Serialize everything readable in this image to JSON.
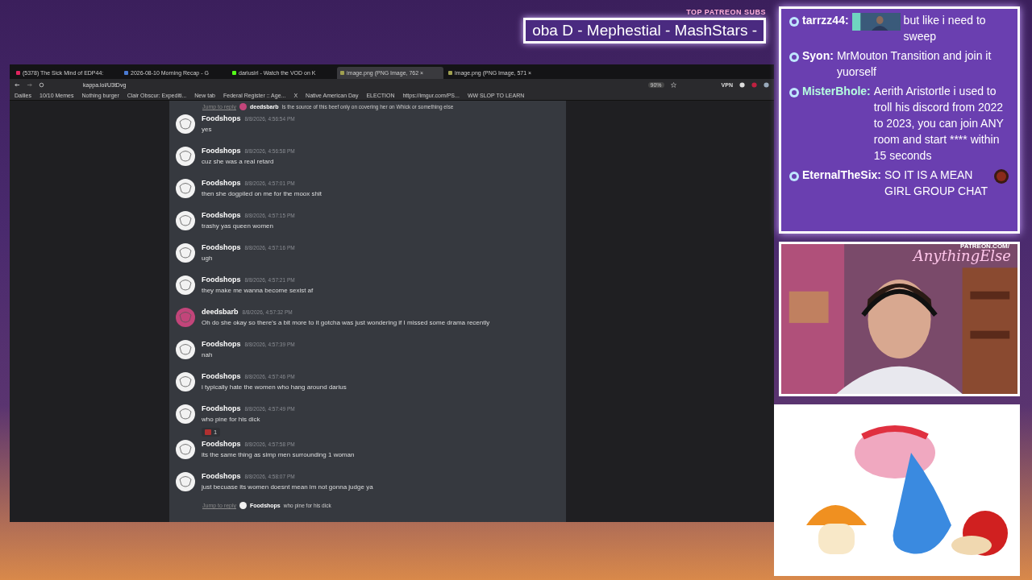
{
  "overlay": {
    "patreon_label": "TOP PATREON SUBS",
    "patreon_ticker": "oba D - Mephestial - MashStars -",
    "patreon_url": "PATREON.COM/",
    "signature": "AnythingElse"
  },
  "browser": {
    "tabs": [
      {
        "title": "(5378) The Sick Mind of EDP44: ",
        "color": "#e0245e",
        "selected": false
      },
      {
        "title": "2026-08-10 Morning Recap - G",
        "color": "#4a7bd4",
        "selected": false
      },
      {
        "title": "dariusirl - Watch the VOD on K",
        "color": "#53fc18",
        "selected": false
      },
      {
        "title": "image.png (PNG Image, 762 ×",
        "color": "#a0a050",
        "selected": true
      },
      {
        "title": "image.png (PNG Image, 571 ×",
        "color": "#a0a050",
        "selected": false
      }
    ],
    "address": "kappa.lol/U3tDvg",
    "zoom": "90%",
    "vpn": "VPN",
    "bookmarks": [
      "Dailies",
      "10/10 Memes",
      "Nothing burger",
      "Clair Obscur: Expediti...",
      "New tab",
      "Federal Register :: Age...",
      "X",
      "Native American Day",
      "ELECTION",
      "https://imgur.com/PS...",
      "WW SLOP TO LEARN"
    ]
  },
  "discord": {
    "reply_top": {
      "label": "Jump to reply",
      "author": "deedsbarb",
      "text": "Is the source of this beef only on covering her on Whick or something else",
      "color": "#c2457a"
    },
    "messages": [
      {
        "author": "Foodshops",
        "time": "8/8/2026, 4:56:54 PM",
        "text": "yes",
        "color": "#f2f2f2"
      },
      {
        "author": "Foodshops",
        "time": "8/8/2026, 4:56:58 PM",
        "text": "cuz she was a real retard",
        "color": "#f2f2f2"
      },
      {
        "author": "Foodshops",
        "time": "8/8/2026, 4:57:01 PM",
        "text": "then she dogpiled on me for the moox shit",
        "color": "#f2f2f2"
      },
      {
        "author": "Foodshops",
        "time": "8/8/2026, 4:57:15 PM",
        "text": "trashy yas queen women",
        "color": "#f2f2f2"
      },
      {
        "author": "Foodshops",
        "time": "8/8/2026, 4:57:16 PM",
        "text": "ugh",
        "color": "#f2f2f2"
      },
      {
        "author": "Foodshops",
        "time": "8/8/2026, 4:57:21 PM",
        "text": "they make me wanna become sexist af",
        "color": "#f2f2f2"
      },
      {
        "author": "deedsbarb",
        "time": "8/8/2026, 4:57:32 PM",
        "text": "Oh do she okay so there's a bit more to it gotcha was just wondering if I missed some drama recently",
        "color": "#c2457a"
      },
      {
        "author": "Foodshops",
        "time": "8/8/2026, 4:57:39 PM",
        "text": "nah",
        "color": "#f2f2f2"
      },
      {
        "author": "Foodshops",
        "time": "8/8/2026, 4:57:46 PM",
        "text": "i typically hate the women who hang around darius",
        "color": "#f2f2f2"
      },
      {
        "author": "Foodshops",
        "time": "8/8/2026, 4:57:49 PM",
        "text": "who pine for his dick",
        "color": "#f2f2f2",
        "reaction": "1"
      },
      {
        "author": "Foodshops",
        "time": "8/8/2026, 4:57:58 PM",
        "text": "its the same thing as simp men surrounding 1 woman",
        "color": "#f2f2f2"
      },
      {
        "author": "Foodshops",
        "time": "8/8/2026, 4:58:07 PM",
        "text": "just becuase its women doesnt mean im not gonna judge ya",
        "color": "#f2f2f2"
      }
    ],
    "reply_bottom": {
      "label": "Jump to reply",
      "author": "Foodshops",
      "text": "who pine for his dick",
      "color": "#f2f2f2"
    }
  },
  "stream_chat": [
    {
      "user": "tarrzz44:",
      "color": "#ffffff",
      "text": "but like i need to sweep",
      "emote_before": true
    },
    {
      "user": "Syon:",
      "color": "#ffffff",
      "text": "MrMouton Transition and join it yuorself"
    },
    {
      "user": "MisterBhole:",
      "color": "#b6ffe0",
      "text": "Aerith Aristortle i used to troll his discord from 2022 to 2023, you can join ANY room and start **** within 15 seconds"
    },
    {
      "user": "EternalTheSix:",
      "color": "#ffffff",
      "text": "SO IT IS A MEAN GIRL GROUP CHAT",
      "emote_after": true
    }
  ]
}
